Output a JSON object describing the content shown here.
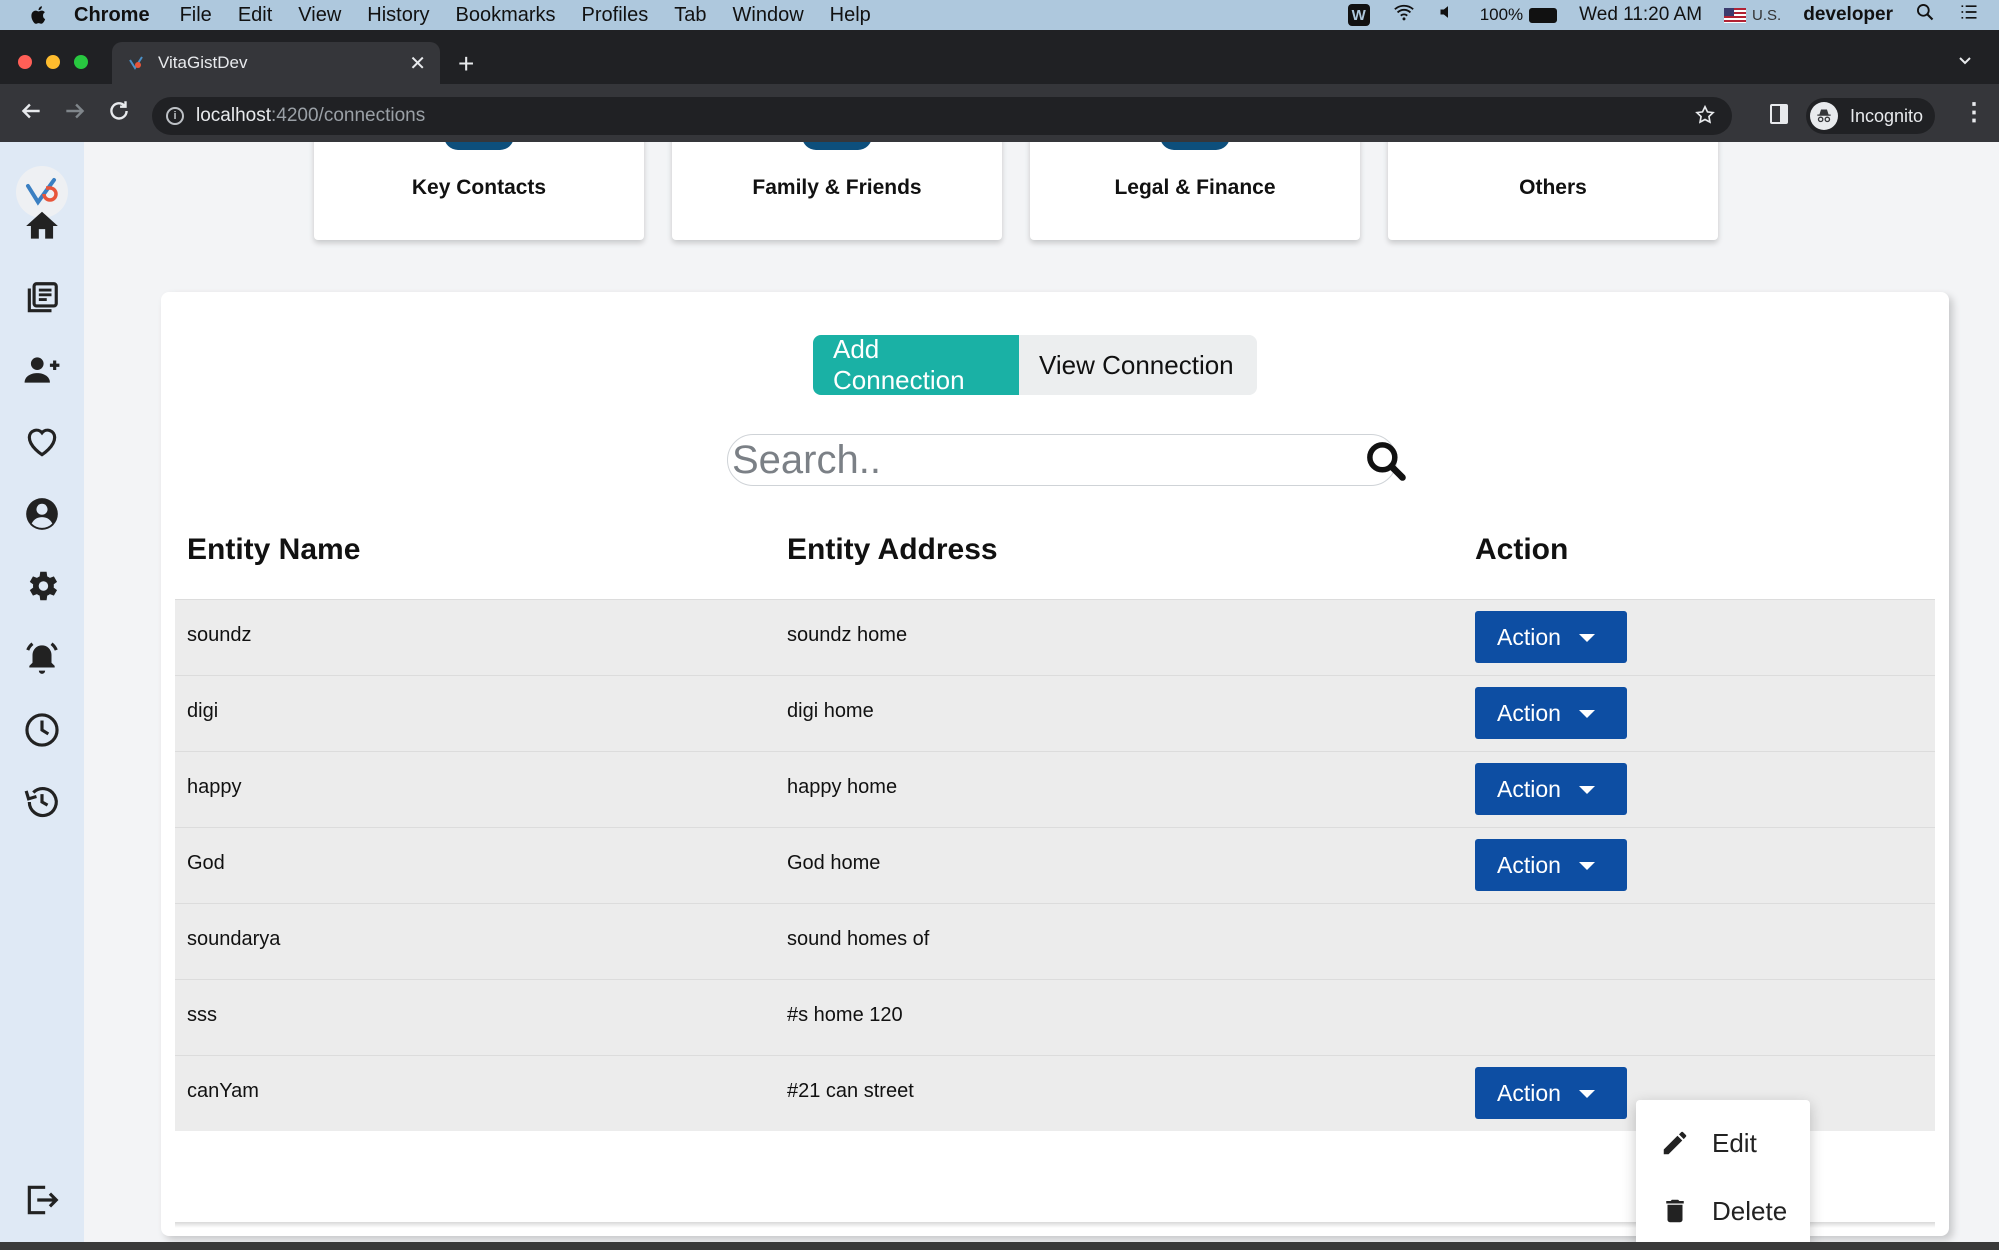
{
  "menubar": {
    "app": "Chrome",
    "items": [
      "File",
      "Edit",
      "View",
      "History",
      "Bookmarks",
      "Profiles",
      "Tab",
      "Window",
      "Help"
    ],
    "battery": "100%",
    "clock": "Wed 11:20 AM",
    "input_source": "U.S.",
    "user": "developer"
  },
  "browser": {
    "tab_title": "VitaGistDev",
    "url_host": "localhost",
    "url_path": ":4200/connections",
    "profile": "Incognito"
  },
  "categories": [
    "Key Contacts",
    "Family & Friends",
    "Legal & Finance",
    "Others"
  ],
  "toggle": {
    "add_label": "Add Connection",
    "view_label": "View Connection",
    "active": "Add Connection",
    "active_color": "#1ab1a5"
  },
  "search": {
    "placeholder": "Search.."
  },
  "table": {
    "headers": [
      "Entity Name",
      "Entity Address",
      "Action"
    ],
    "action_label": "Action",
    "action_color": "#0d4ea3",
    "rows": [
      {
        "name": "soundz",
        "address": "soundz home"
      },
      {
        "name": "digi",
        "address": "digi home"
      },
      {
        "name": "happy",
        "address": "happy home"
      },
      {
        "name": "God",
        "address": "God home"
      },
      {
        "name": "soundarya",
        "address": "sound homes of"
      },
      {
        "name": "sss",
        "address": "#s home 120"
      },
      {
        "name": "canYam",
        "address": "#21 can street"
      }
    ]
  },
  "dropdown": {
    "items": [
      "Edit",
      "Delete"
    ]
  },
  "icons": {
    "sidebar": [
      "home-icon",
      "library-icon",
      "add-user-icon",
      "heart-icon",
      "account-icon",
      "settings-icon",
      "alarm-icon",
      "clock-icon",
      "history-icon",
      "logout-icon"
    ]
  }
}
